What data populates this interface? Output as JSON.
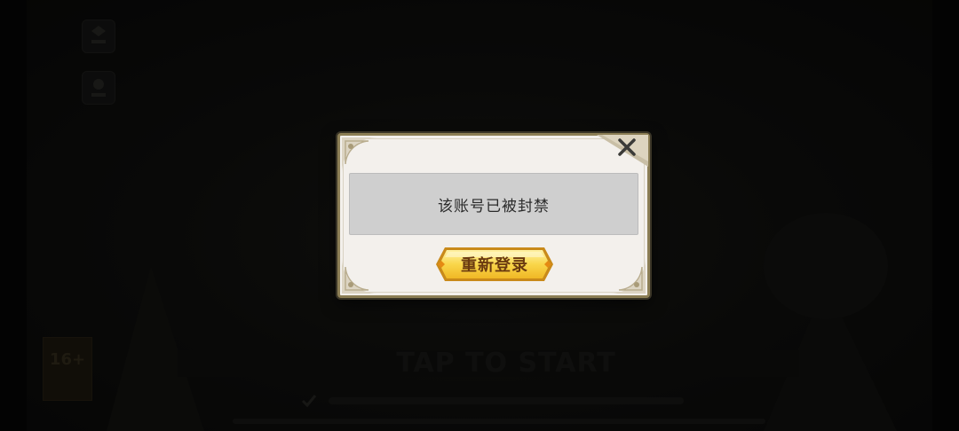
{
  "dialog": {
    "message": "该账号已被封禁",
    "relogin_label": "重新登录",
    "close_icon": "close-icon"
  },
  "background": {
    "tap_to_start": "TAP TO START",
    "age_rating": "16+"
  },
  "colors": {
    "dialog_bg": "#f3f0ec",
    "dialog_border": "#8c7e55",
    "message_bg": "#cfcfcf",
    "button_gold": "#f7d24a",
    "button_text": "#6a3a10"
  }
}
